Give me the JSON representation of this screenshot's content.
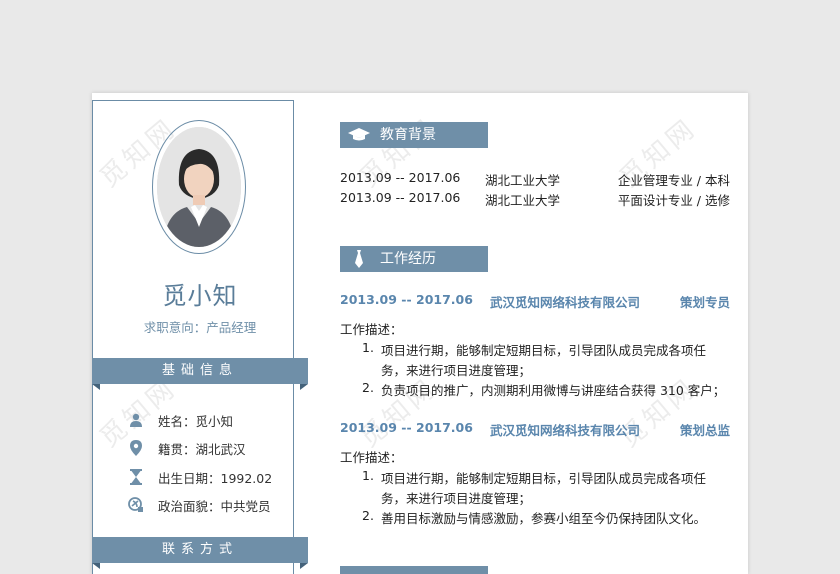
{
  "profile": {
    "name": "觅小知",
    "intent": "求职意向：产品经理"
  },
  "sidebar": {
    "basic_title": "基础信息",
    "contact_title": "联系方式",
    "info": [
      {
        "icon": "person-icon",
        "text": "姓名：觅小知"
      },
      {
        "icon": "location-pin-icon",
        "text": "籍贯：湖北武汉"
      },
      {
        "icon": "hourglass-icon",
        "text": "出生日期：1992.02"
      },
      {
        "icon": "party-badge-icon",
        "text": "政治面貌：中共党员"
      }
    ]
  },
  "education": {
    "title": "教育背景",
    "rows": [
      {
        "period": "2013.09 -- 2017.06",
        "school": "湖北工业大学",
        "major": "企业管理专业 / 本科"
      },
      {
        "period": "2013.09 -- 2017.06",
        "school": "湖北工业大学",
        "major": "平面设计专业 / 选修"
      }
    ]
  },
  "work": {
    "title": "工作经历",
    "jobs": [
      {
        "period": "2013.09 -- 2017.06",
        "company": "武汉觅知网络科技有限公司",
        "role": "策划专员",
        "desc_label": "工作描述：",
        "items": [
          {
            "num": "1.",
            "lines": [
              "项目进行期，能够制定短期目标，引导团队成员完成各项任",
              "务，来进行项目进度管理；"
            ]
          },
          {
            "num": "2.",
            "lines": [
              "负责项目的推广，内测期利用微博与讲座结合获得 310 客户；"
            ]
          }
        ]
      },
      {
        "period": "2013.09 -- 2017.06",
        "company": "武汉觅知网络科技有限公司",
        "role": "策划总监",
        "desc_label": "工作描述：",
        "items": [
          {
            "num": "1.",
            "lines": [
              "项目进行期，能够制定短期目标，引导团队成员完成各项任",
              "务，来进行项目进度管理；"
            ]
          },
          {
            "num": "2.",
            "lines": [
              "善用目标激励与情感激励，参赛小组至今仍保持团队文化。"
            ]
          }
        ]
      }
    ]
  },
  "watermark": "觅知网",
  "colors": {
    "accent": "#6f8fa8",
    "accent_dark": "#44627a",
    "job_blue": "#5a86ad"
  }
}
